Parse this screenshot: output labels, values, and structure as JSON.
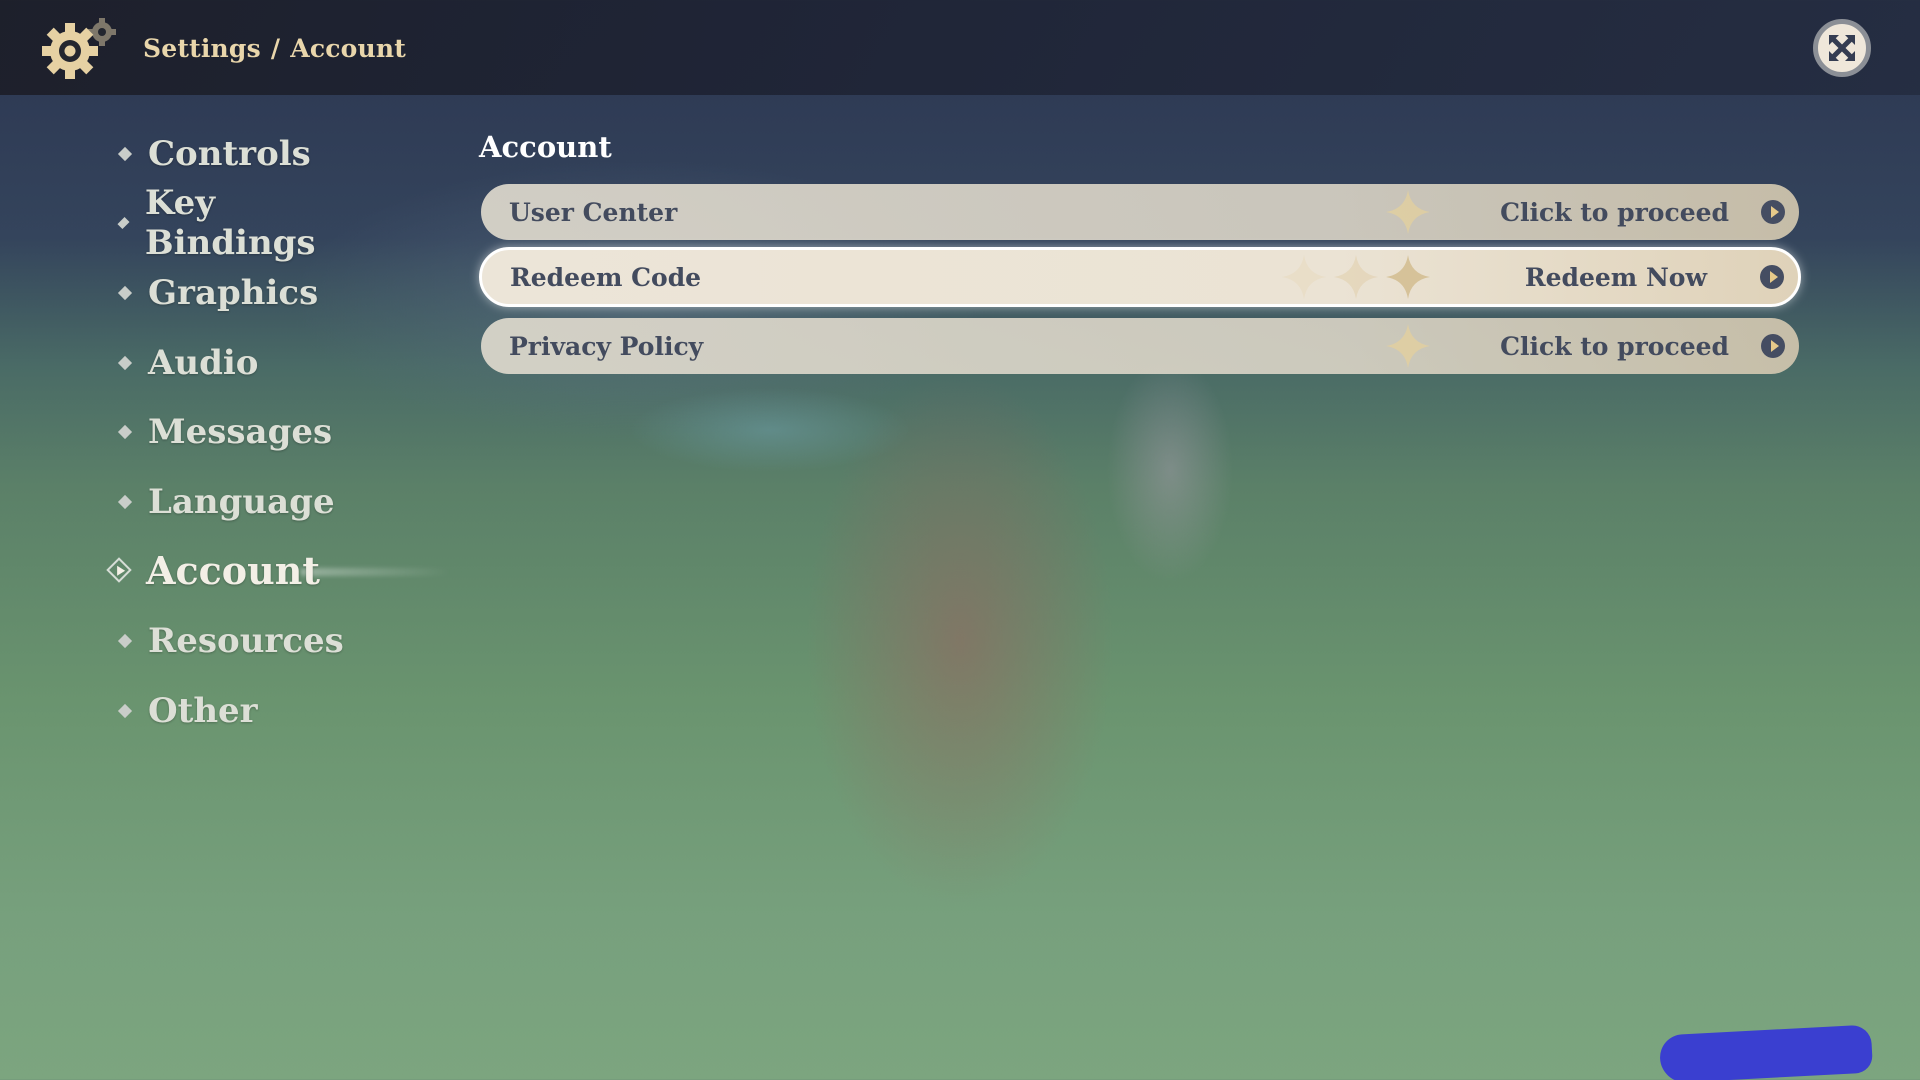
{
  "header": {
    "icon": "gear-icon",
    "breadcrumb": [
      "Settings",
      "/",
      "Account"
    ],
    "close_icon": "close-icon"
  },
  "sidebar": {
    "items": [
      {
        "label": "Controls",
        "active": false
      },
      {
        "label": "Key Bindings",
        "active": false
      },
      {
        "label": "Graphics",
        "active": false
      },
      {
        "label": "Audio",
        "active": false
      },
      {
        "label": "Messages",
        "active": false
      },
      {
        "label": "Language",
        "active": false
      },
      {
        "label": "Account",
        "active": true
      },
      {
        "label": "Resources",
        "active": false
      },
      {
        "label": "Other",
        "active": false
      }
    ]
  },
  "main": {
    "title": "Account",
    "rows": [
      {
        "label": "User Center",
        "action": "Click to proceed",
        "selected": false
      },
      {
        "label": "Redeem Code",
        "action": "Redeem Now",
        "selected": true
      },
      {
        "label": "Privacy Policy",
        "action": "Click to proceed",
        "selected": false
      }
    ]
  },
  "colors": {
    "breadcrumb": "#e9d6ab",
    "row_text": "#434b5e",
    "arrow_bg": "#454d62",
    "arrow_glyph": "#e6c98a",
    "redaction": "#3a3fd0"
  }
}
